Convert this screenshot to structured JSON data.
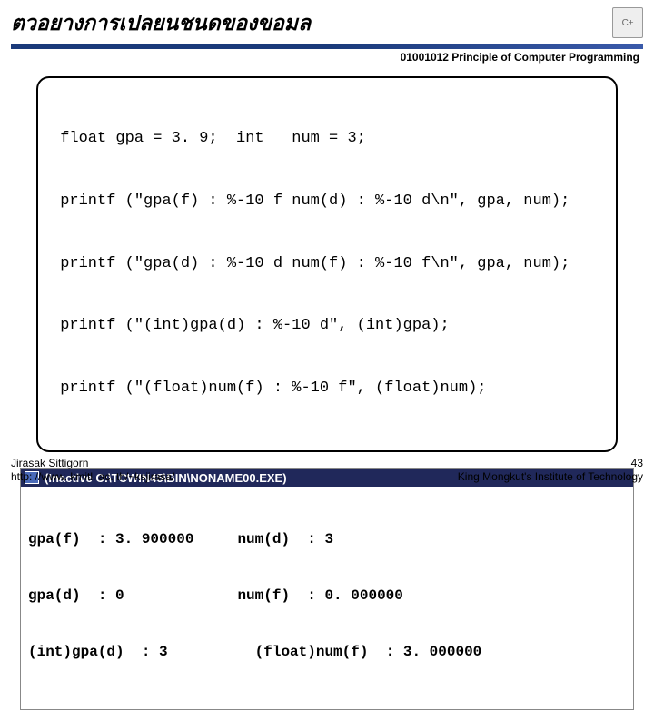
{
  "title": "ตวอยางการเปลยนชนดของขอมล",
  "course": "01001012 Principle of Computer Programming",
  "code_lines": [
    " float gpa = 3. 9;  int   num = 3;",
    " printf (\"gpa(f) : %-10 f num(d) : %-10 d\\n\", gpa, num);",
    " printf (\"gpa(d) : %-10 d num(f) : %-10 f\\n\", gpa, num);",
    " printf (\"(int)gpa(d) : %-10 d\", (int)gpa);",
    " printf (\"(float)num(f) : %-10 f\", (float)num);"
  ],
  "output_title": "(Inactive C:\\TCWIN45\\BIN\\NONAME00.EXE)",
  "output_lines": [
    "gpa(f)  : 3. 900000     num(d)  : 3",
    "gpa(d)  : 0             num(f)  : 0. 000000",
    "(int)gpa(d)  : 3          (float)num(f)  : 3. 000000"
  ],
  "footer": {
    "author": "Jirasak Sittigorn",
    "url": "http: //www. kmitl. ac. th/~ksjirasa/",
    "page": "43",
    "institute": "King Mongkut's Institute of Technology"
  },
  "logo_text": "C±"
}
